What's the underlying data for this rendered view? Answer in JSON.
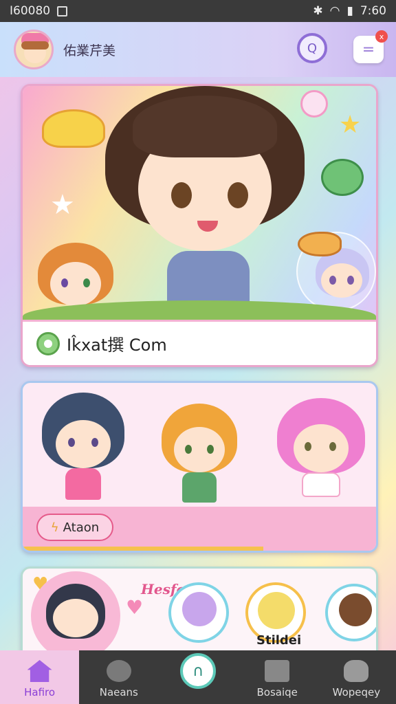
{
  "status_bar": {
    "left_text": "I60080",
    "time": "7:60"
  },
  "header": {
    "title": "佑業芹美",
    "search_glyph": "Q",
    "menu_glyph": "=",
    "notification_glyph": "x"
  },
  "feed": {
    "featured_caption": "Ik̂xat撰 Com",
    "action_button_label": "Ataon",
    "banner_title": "Hesfoel",
    "sub_label": "Stildei"
  },
  "nav": {
    "items": [
      {
        "label": "Hafiro"
      },
      {
        "label": "Naeans"
      },
      {
        "label": ""
      },
      {
        "label": "Bosaiqe"
      },
      {
        "label": "Wopeqey"
      }
    ]
  },
  "colors": {
    "accent": "#a15fe3",
    "pink": "#e55a8a",
    "teal": "#5cc9b8"
  }
}
